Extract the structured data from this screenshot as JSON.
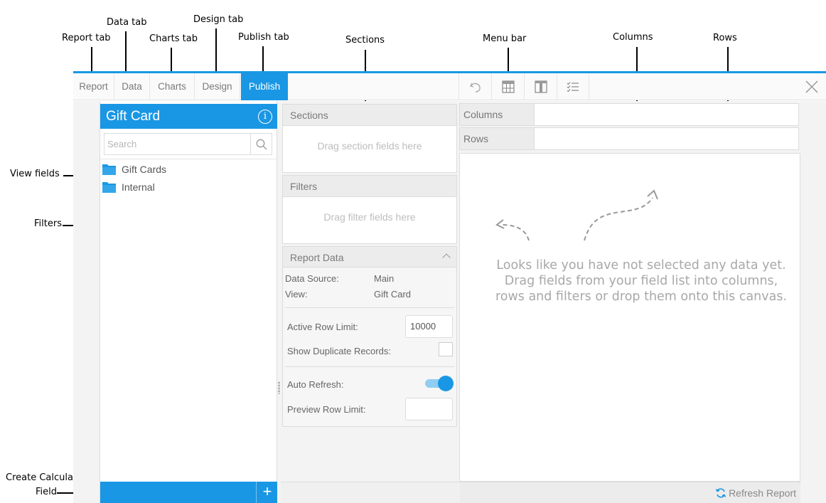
{
  "annotations": {
    "report_tab": "Report tab",
    "data_tab": "Data tab",
    "charts_tab": "Charts tab",
    "design_tab": "Design tab",
    "publish_tab": "Publish tab",
    "sections": "Sections",
    "menu_bar": "Menu bar",
    "columns": "Columns",
    "rows": "Rows",
    "view_fields": "View fields",
    "filters": "Filters",
    "create_calculated_line1": "Create Calculated",
    "create_calculated_line2": "Field"
  },
  "tabs": [
    {
      "label": "Report"
    },
    {
      "label": "Data"
    },
    {
      "label": "Charts"
    },
    {
      "label": "Design"
    },
    {
      "label": "Publish"
    }
  ],
  "menu_icons": [
    "undo-icon",
    "table-icon",
    "columns-icon",
    "list-check-icon"
  ],
  "field_panel": {
    "title": "Gift Card",
    "search_placeholder": "Search",
    "folders": [
      "Gift Cards",
      "Internal"
    ]
  },
  "sections": {
    "title": "Sections",
    "drop_text": "Drag section fields here"
  },
  "filters": {
    "title": "Filters",
    "drop_text": "Drag filter fields here"
  },
  "report_data": {
    "title": "Report Data",
    "data_source_label": "Data Source:",
    "data_source_value": "Main",
    "view_label": "View:",
    "view_value": "Gift Card",
    "active_row_limit_label": "Active Row Limit:",
    "active_row_limit_value": "10000",
    "show_duplicates_label": "Show Duplicate Records:",
    "show_duplicates_checked": false,
    "auto_refresh_label": "Auto Refresh:",
    "auto_refresh_on": true,
    "preview_row_limit_label": "Preview Row Limit:",
    "preview_row_limit_value": ""
  },
  "canvas": {
    "columns_label": "Columns",
    "rows_label": "Rows",
    "empty_message": "Looks like you have not selected any data yet. Drag fields from your field list into columns, rows and filters or drop them onto this canvas.",
    "refresh_label": "Refresh Report"
  },
  "colors": {
    "accent": "#1a97e4"
  }
}
